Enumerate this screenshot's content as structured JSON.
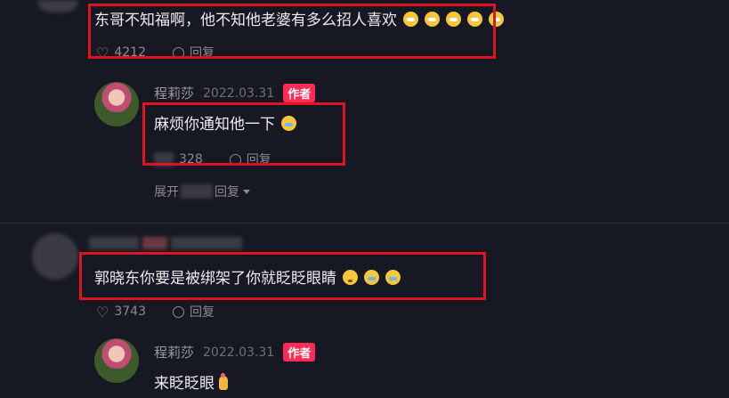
{
  "comment1": {
    "text": "东哥不知福啊，他不知他老婆有多么招人喜欢",
    "likes": "4212",
    "reply_label": "回复"
  },
  "reply1": {
    "author": "程莉莎",
    "date": "2022.03.31",
    "badge": "作者",
    "text": "麻烦你通知他一下",
    "likes_visible": "328",
    "reply_label": "回复",
    "expand_prefix": "展开",
    "expand_suffix": "回复"
  },
  "comment2": {
    "text": "郭晓东你要是被绑架了你就眨眨眼睛",
    "likes": "3743",
    "reply_label": "回复"
  },
  "reply2": {
    "author": "程莉莎",
    "date": "2022.03.31",
    "badge": "作者",
    "text": "来眨眨眼"
  },
  "icons": {
    "like": "heart-outline-icon",
    "reply": "speech-bubble-icon",
    "expand": "caret-down-icon"
  },
  "colors": {
    "background": "#161823",
    "highlight_box": "#e0141e",
    "author_badge": "#fe2c55"
  }
}
